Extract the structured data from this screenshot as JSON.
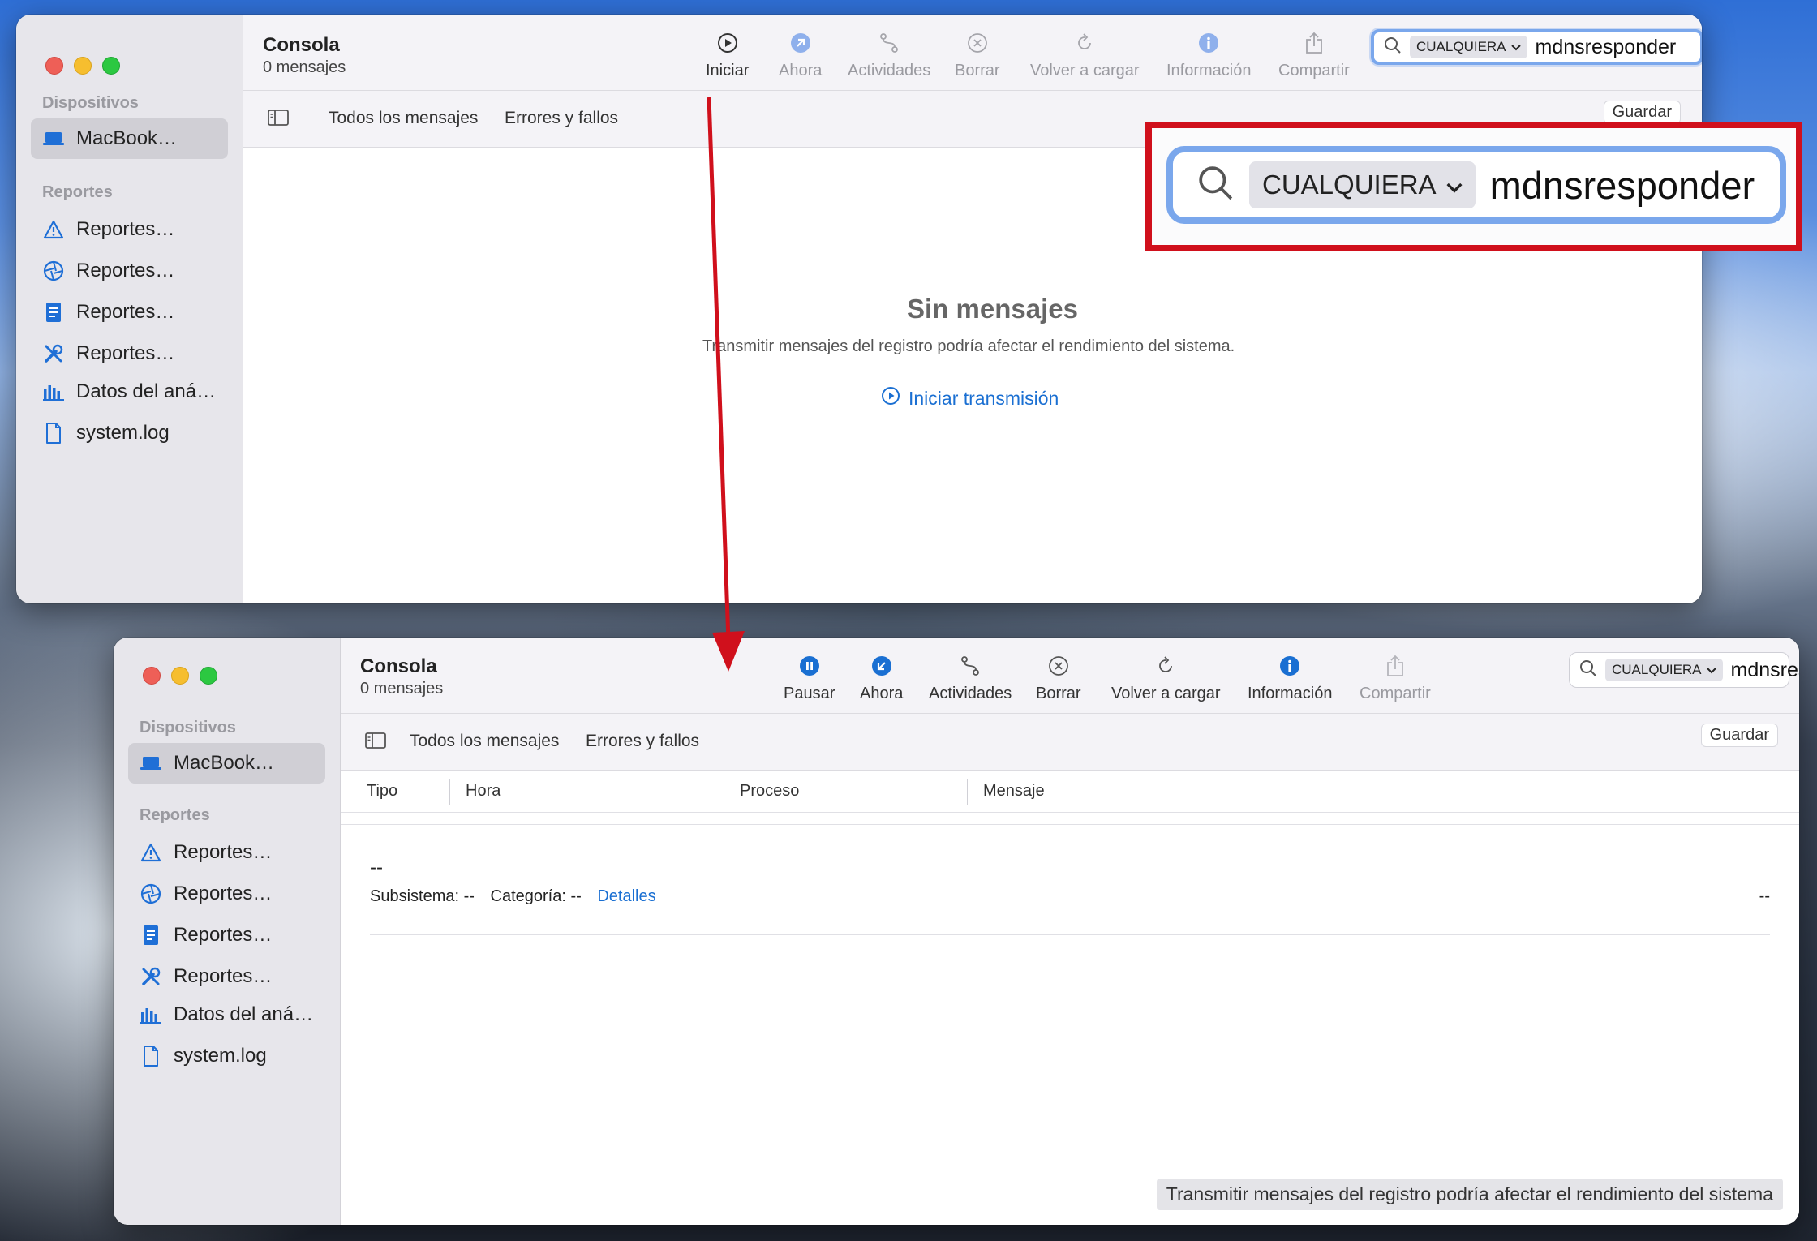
{
  "window1": {
    "sidebar": {
      "devices_header": "Dispositivos",
      "device_item": "MacBook…",
      "reports_header": "Reportes",
      "items": [
        "Reportes…",
        "Reportes…",
        "Reportes…",
        "Reportes…",
        "Datos del aná…",
        "system.log"
      ]
    },
    "toolbar": {
      "title": "Consola",
      "subtitle": "0 mensajes",
      "start": "Iniciar",
      "now": "Ahora",
      "activities": "Actividades",
      "clear": "Borrar",
      "reload": "Volver a cargar",
      "info": "Información",
      "share": "Compartir"
    },
    "search": {
      "scope": "CUALQUIERA",
      "query": "mdnsresponder"
    },
    "filters": {
      "all": "Todos los mensajes",
      "errors": "Errores y fallos",
      "save": "Guardar"
    },
    "empty": {
      "title": "Sin mensajes",
      "message": "Transmitir mensajes del registro podría afectar el rendimiento del sistema.",
      "start_link": "Iniciar transmisión"
    },
    "zoom": {
      "scope": "CUALQUIERA",
      "query": "mdnsresponder"
    }
  },
  "window2": {
    "sidebar": {
      "devices_header": "Dispositivos",
      "device_item": "MacBook…",
      "reports_header": "Reportes",
      "items": [
        "Reportes…",
        "Reportes…",
        "Reportes…",
        "Reportes…",
        "Datos del aná…",
        "system.log"
      ]
    },
    "toolbar": {
      "title": "Consola",
      "subtitle": "0 mensajes",
      "pause": "Pausar",
      "now": "Ahora",
      "activities": "Actividades",
      "clear": "Borrar",
      "reload": "Volver a cargar",
      "info": "Información",
      "share": "Compartir"
    },
    "search": {
      "scope": "CUALQUIERA",
      "query": "mdnsresponder"
    },
    "filters": {
      "all": "Todos los mensajes",
      "errors": "Errores y fallos",
      "save": "Guardar"
    },
    "columns": [
      "Tipo",
      "Hora",
      "Proceso",
      "Mensaje"
    ],
    "detail": {
      "dash": "--",
      "subsystem_label": "Subsistema:",
      "subsystem_value": "--",
      "category_label": "Categoría:",
      "category_value": "--",
      "details_link": "Detalles",
      "right_dash": "--"
    },
    "banner": "Transmitir mensajes del registro podría afectar el rendimiento del sistema"
  },
  "colors": {
    "accent": "#1a6fd2",
    "highlight": "#d0101c",
    "focus_ring": "#7aa7ec"
  }
}
